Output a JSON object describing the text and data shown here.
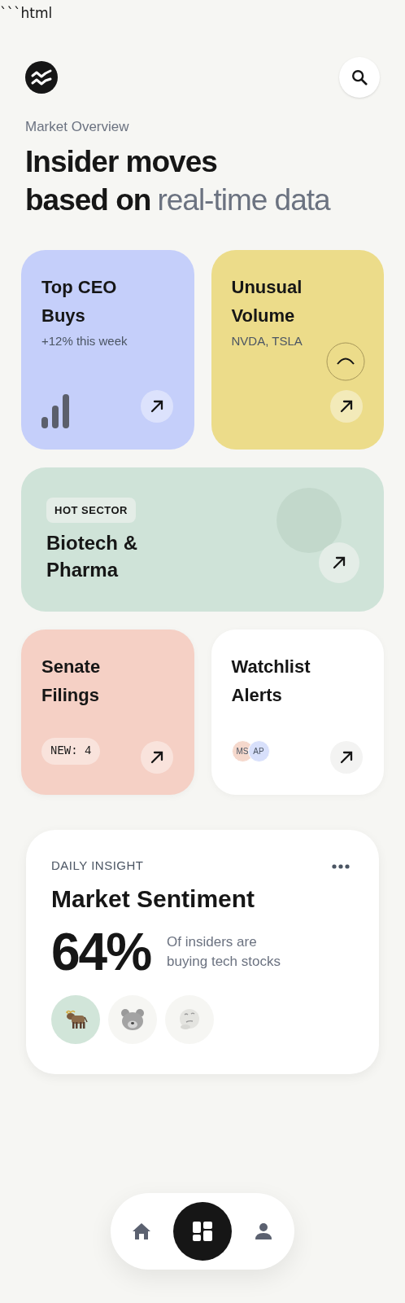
{
  "stray_text": "```html",
  "header": {
    "subtitle": "Market Overview",
    "title_bold_1": "Insider moves",
    "title_bold_2": "based on",
    "title_light": "real-time data"
  },
  "cards": [
    {
      "kind": "bars",
      "title": "Top CEO Buys",
      "subtitle": "+12% this week",
      "color": "#c5cffa"
    },
    {
      "kind": "volume",
      "title": "Unusual Volume",
      "subtitle": "NVDA, TSLA",
      "color": "#ecdc8a"
    }
  ],
  "featured": {
    "badge": "HOT SECTOR",
    "title": "Biotech & Pharma"
  },
  "small_cards": [
    {
      "kind": "counter",
      "title": "Senate Filings",
      "badge": "NEW: 4",
      "color": "#f5d0c5"
    },
    {
      "kind": "avatars",
      "title": "Watchlist Alerts",
      "avatars": [
        "MS",
        "AP"
      ],
      "color": "#ffffff"
    }
  ],
  "insight": {
    "label": "DAILY INSIGHT",
    "title": "Market Sentiment",
    "percent": "64%",
    "caption": "Of insiders are buying tech stocks",
    "moods": [
      {
        "kind": "bull",
        "selected": true
      },
      {
        "kind": "bear",
        "selected": false
      },
      {
        "kind": "thinking",
        "selected": false
      }
    ]
  },
  "nav": [
    {
      "kind": "home",
      "selected": false
    },
    {
      "kind": "dashboard",
      "selected": true
    },
    {
      "kind": "profile",
      "selected": false
    }
  ]
}
